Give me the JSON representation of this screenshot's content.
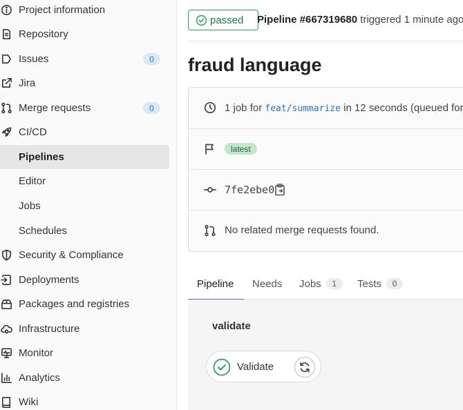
{
  "sidebar": {
    "items": [
      {
        "label": "Project information",
        "icon": "info-icon"
      },
      {
        "label": "Repository",
        "icon": "document-icon"
      },
      {
        "label": "Issues",
        "icon": "issues-icon",
        "count": "0"
      },
      {
        "label": "Jira",
        "icon": "external-link-icon"
      },
      {
        "label": "Merge requests",
        "icon": "merge-request-icon",
        "count": "0"
      },
      {
        "label": "CI/CD",
        "icon": "rocket-icon"
      }
    ],
    "cicd_sub": [
      "Pipelines",
      "Editor",
      "Jobs",
      "Schedules"
    ],
    "active_sub": "Pipelines",
    "items_after": [
      {
        "label": "Security & Compliance",
        "icon": "shield-icon"
      },
      {
        "label": "Deployments",
        "icon": "deployments-icon"
      },
      {
        "label": "Packages and registries",
        "icon": "package-icon"
      },
      {
        "label": "Infrastructure",
        "icon": "cloud-gear-icon"
      },
      {
        "label": "Monitor",
        "icon": "monitor-icon"
      },
      {
        "label": "Analytics",
        "icon": "chart-icon"
      },
      {
        "label": "Wiki",
        "icon": "book-icon"
      }
    ]
  },
  "header": {
    "status": "passed",
    "pipeline_id": "Pipeline #667319680",
    "triggered_text": "triggered 1 minute ago"
  },
  "pipeline": {
    "title": "fraud language",
    "jobs_prefix": "1 job for",
    "branch": "feat/summarize",
    "duration_text": "in 12 seconds (queued for",
    "badge": "latest",
    "commit": "7fe2ebe0",
    "mr_text": "No related merge requests found."
  },
  "tabs": [
    {
      "label": "Pipeline"
    },
    {
      "label": "Needs"
    },
    {
      "label": "Jobs",
      "count": "1"
    },
    {
      "label": "Tests",
      "count": "0"
    }
  ],
  "graph": {
    "stage": "validate",
    "job": "Validate"
  },
  "colors": {
    "success": "#2da160",
    "link": "#1f75cb",
    "tab_indicator": "#6666c4",
    "count_badge": "#dbe9f7"
  }
}
